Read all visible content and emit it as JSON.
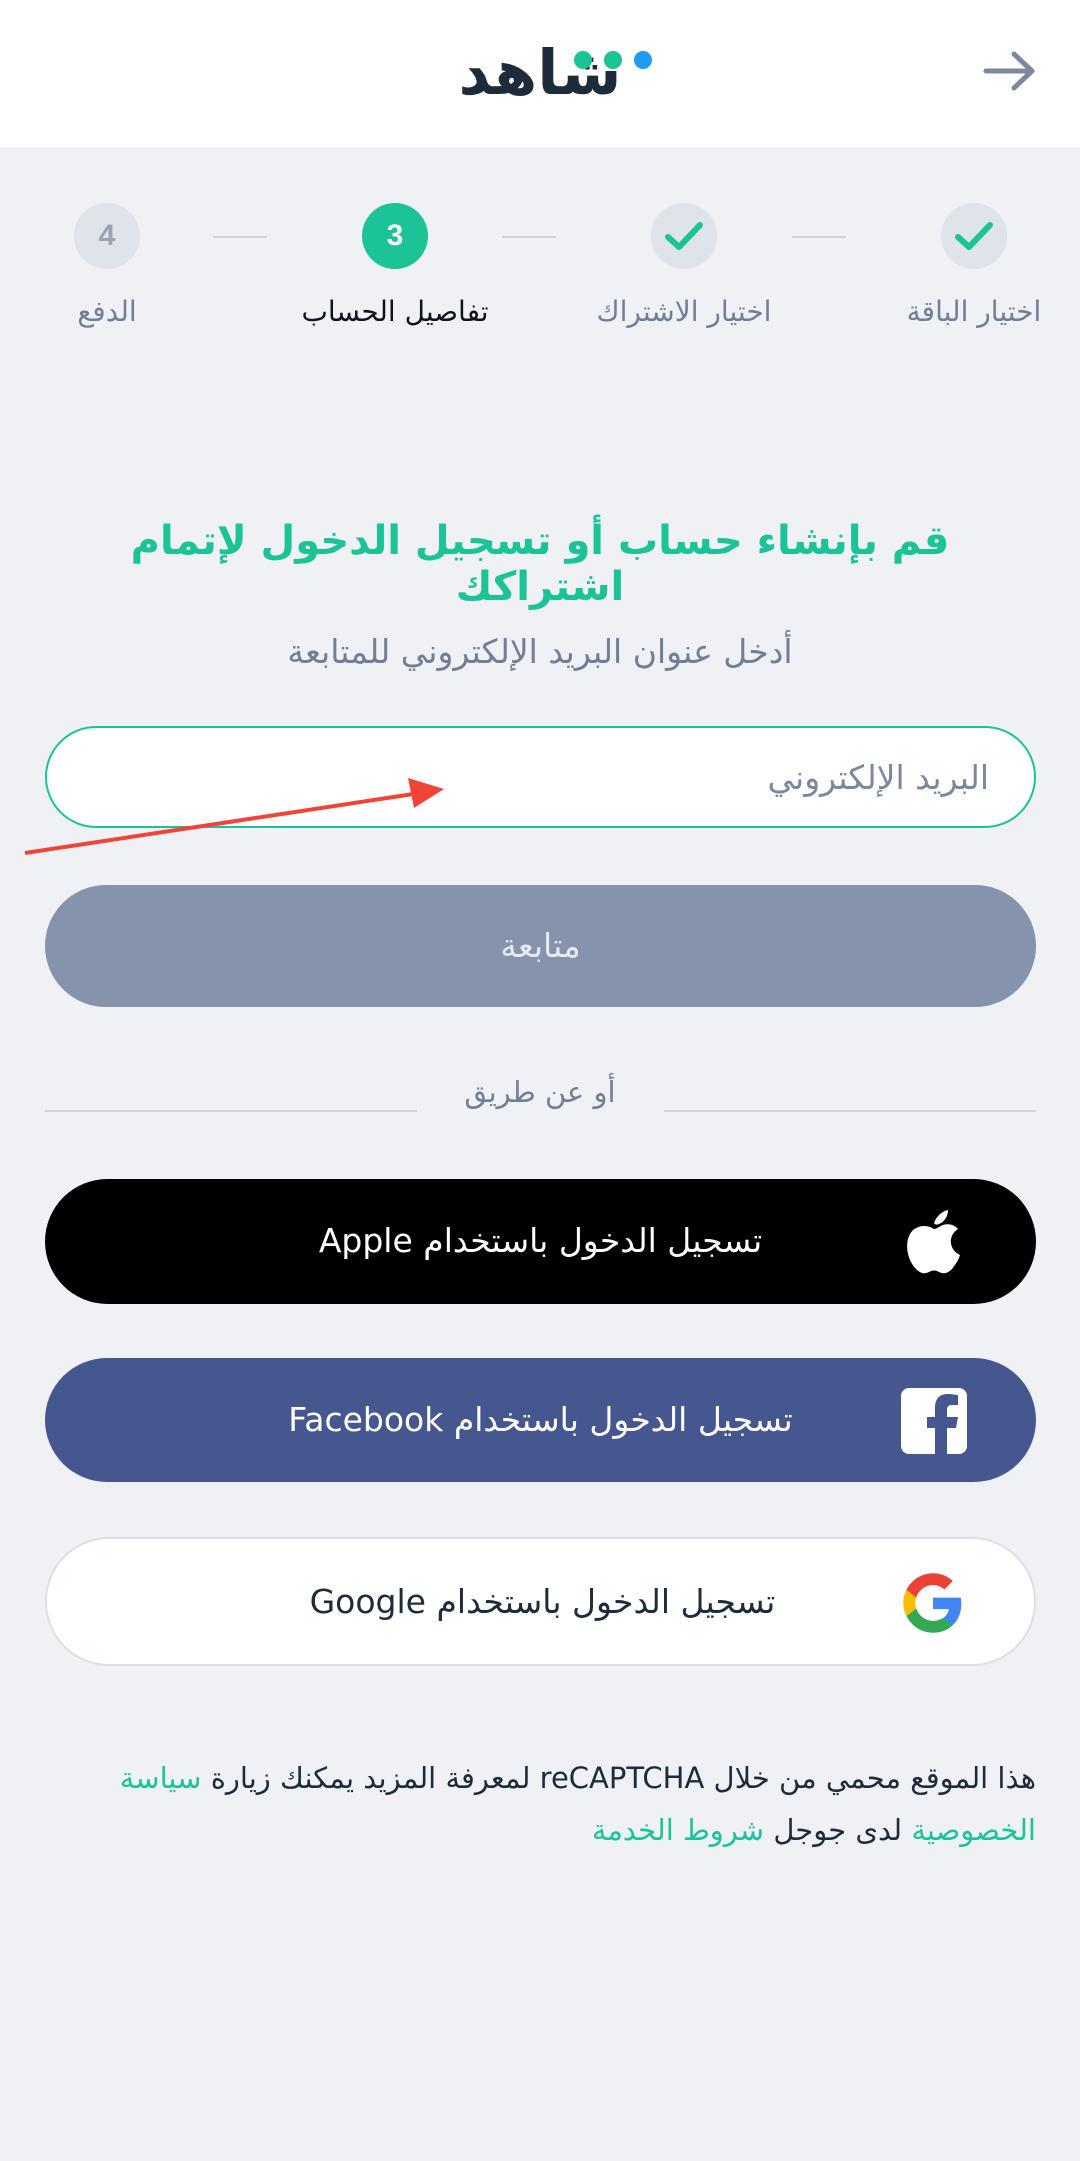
{
  "header": {
    "logo_text": "شاهد",
    "logo_dots": [
      "#1cc397",
      "#1cc397",
      "#1e9df0"
    ],
    "back_icon": "arrow-right-icon"
  },
  "stepper": {
    "steps": [
      {
        "label": "اختيار الباقة",
        "state": "completed",
        "icon": "check-icon"
      },
      {
        "label": "اختيار الاشتراك",
        "state": "completed",
        "icon": "check-icon"
      },
      {
        "label": "تفاصيل الحساب",
        "state": "active",
        "number": "3"
      },
      {
        "label": "الدفع",
        "state": "upcoming",
        "number": "4"
      }
    ]
  },
  "form": {
    "title": "قم بإنشاء حساب أو تسجيل الدخول لإتمام اشتراكك",
    "subtitle": "أدخل عنوان البريد الإلكتروني للمتابعة",
    "email_placeholder": "البريد الإلكتروني",
    "email_value": "",
    "continue_label": "متابعة"
  },
  "divider": {
    "label": "أو عن طريق"
  },
  "social": {
    "apple_label": "تسجيل الدخول باستخدام Apple",
    "facebook_label": "تسجيل الدخول باستخدام Facebook",
    "google_label": "تسجيل الدخول باستخدام Google"
  },
  "footer": {
    "recaptcha_text_1": "هذا الموقع محمي من خلال reCAPTCHA لمعرفة المزيد يمكنك زيارة",
    "privacy_link": "سياسة الخصوصية",
    "recaptcha_text_2": "لدى جوجل",
    "terms_link": "شروط الخدمة"
  },
  "colors": {
    "accent": "#1cc397",
    "background": "#eff1f5",
    "continue_disabled": "#8693ad",
    "facebook": "#465790",
    "annotation_arrow": "#f04438"
  }
}
